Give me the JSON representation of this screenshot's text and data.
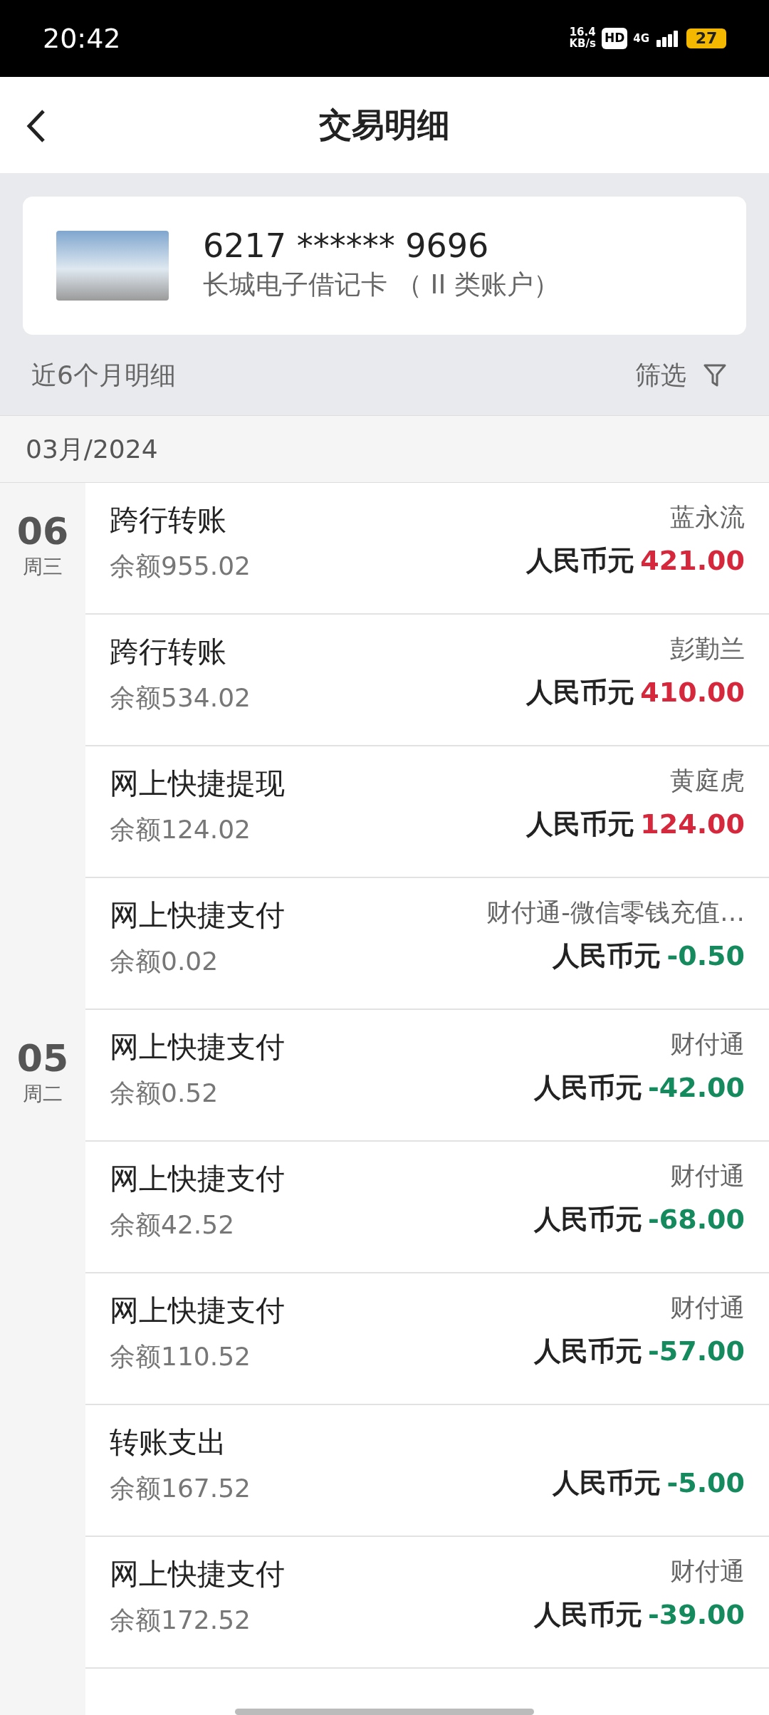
{
  "status_bar": {
    "time": "20:42",
    "net_speed": "16.4",
    "net_unit": "KB/s",
    "hd": "HD",
    "network": "4G",
    "battery": "27"
  },
  "header": {
    "title": "交易明细"
  },
  "account_card": {
    "number": "6217 ****** 9696",
    "name": "长城电子借记卡 （ II 类账户）"
  },
  "filter_bar": {
    "period": "近6个月明细",
    "filter": "筛选"
  },
  "month": "03月/2024",
  "days": [
    {
      "day": "06",
      "weekday": "周三",
      "transactions": [
        {
          "type": "跨行转账",
          "balance": "余额955.02",
          "counterparty": "蓝永流",
          "currency": "人民币元",
          "amount": "421.00",
          "kind": "income"
        },
        {
          "type": "跨行转账",
          "balance": "余额534.02",
          "counterparty": "彭勤兰",
          "currency": "人民币元",
          "amount": "410.00",
          "kind": "income"
        },
        {
          "type": "网上快捷提现",
          "balance": "余额124.02",
          "counterparty": "黄庭虎",
          "currency": "人民币元",
          "amount": "124.00",
          "kind": "income"
        },
        {
          "type": "网上快捷支付",
          "balance": "余额0.02",
          "counterparty": "财付通-微信零钱充值…",
          "currency": "人民币元",
          "amount": "-0.50",
          "kind": "expense"
        }
      ]
    },
    {
      "day": "05",
      "weekday": "周二",
      "transactions": [
        {
          "type": "网上快捷支付",
          "balance": "余额0.52",
          "counterparty": "财付通",
          "currency": "人民币元",
          "amount": "-42.00",
          "kind": "expense"
        },
        {
          "type": "网上快捷支付",
          "balance": "余额42.52",
          "counterparty": "财付通",
          "currency": "人民币元",
          "amount": "-68.00",
          "kind": "expense"
        },
        {
          "type": "网上快捷支付",
          "balance": "余额110.52",
          "counterparty": "财付通",
          "currency": "人民币元",
          "amount": "-57.00",
          "kind": "expense"
        },
        {
          "type": "转账支出",
          "balance": "余额167.52",
          "currency": "人民币元",
          "amount": "-5.00",
          "kind": "expense"
        },
        {
          "type": "网上快捷支付",
          "balance": "余额172.52",
          "counterparty": "财付通",
          "currency": "人民币元",
          "amount": "-39.00",
          "kind": "expense"
        }
      ]
    }
  ]
}
